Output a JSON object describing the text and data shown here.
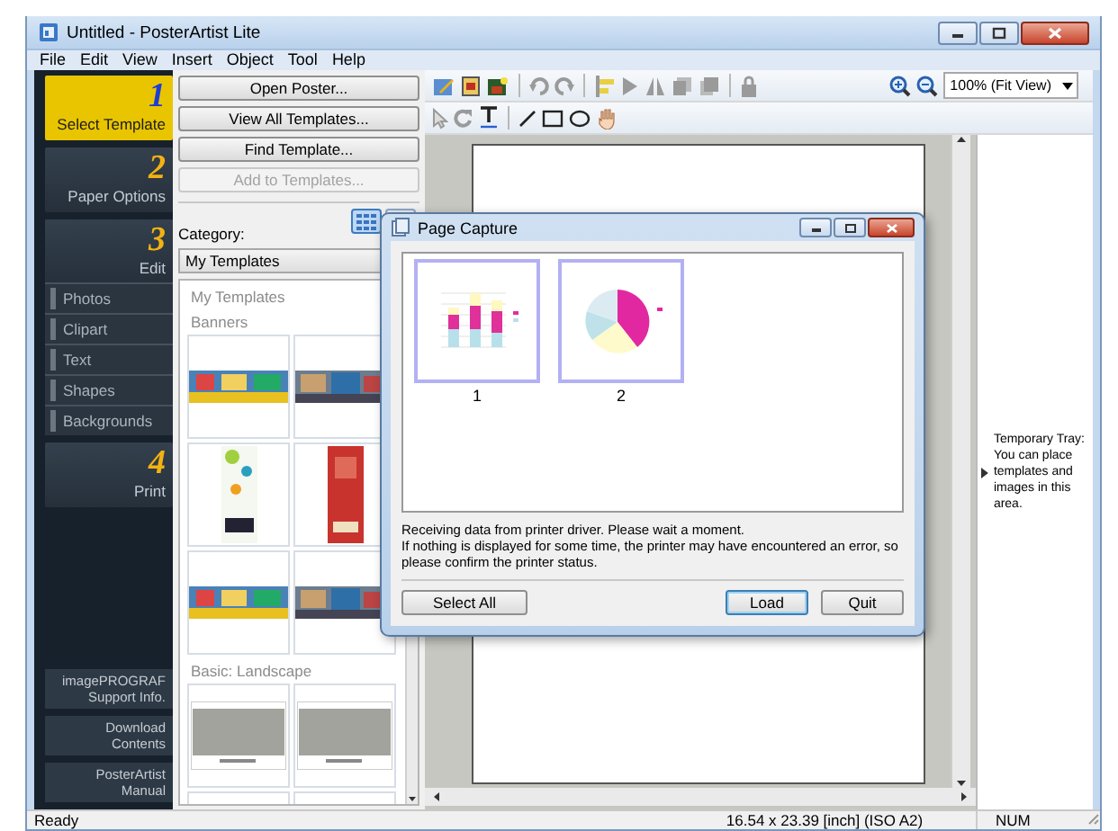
{
  "window": {
    "title": "Untitled - PosterArtist Lite"
  },
  "menu": [
    "File",
    "Edit",
    "View",
    "Insert",
    "Object",
    "Tool",
    "Help"
  ],
  "steps": [
    {
      "number": "1",
      "label": "Select Template",
      "selected": true
    },
    {
      "number": "2",
      "label": "Paper Options",
      "selected": false
    },
    {
      "number": "3",
      "label": "Edit",
      "selected": false,
      "tools": [
        "Photos",
        "Clipart",
        "Text",
        "Shapes",
        "Backgrounds"
      ]
    },
    {
      "number": "4",
      "label": "Print",
      "selected": false
    }
  ],
  "sidebar_links": [
    "imagePROGRAF Support Info.",
    "Download Contents",
    "PosterArtist Manual"
  ],
  "template_panel": {
    "buttons": [
      {
        "label": "Open Poster...",
        "disabled": false
      },
      {
        "label": "View All Templates...",
        "disabled": false
      },
      {
        "label": "Find Template...",
        "disabled": false
      },
      {
        "label": "Add to Templates...",
        "disabled": true
      }
    ],
    "view_modes": [
      {
        "kind": "grid",
        "selected": true
      },
      {
        "kind": "list",
        "selected": false
      }
    ],
    "category_label": "Category:",
    "category": "My Templates",
    "groups": [
      {
        "heading": "My Templates"
      },
      {
        "heading": "Banners",
        "templates": [
          {
            "kind": "wide"
          },
          {
            "kind": "wide"
          },
          {
            "kind": "tall"
          },
          {
            "kind": "tall"
          },
          {
            "kind": "wide"
          },
          {
            "kind": "wide"
          }
        ]
      },
      {
        "heading": "Basic: Landscape",
        "templates": [
          {
            "kind": "layout"
          },
          {
            "kind": "layout"
          },
          {
            "kind": "layout"
          },
          {
            "kind": "layout"
          }
        ]
      }
    ]
  },
  "toolbar": {
    "zoom": "100% (Fit View)"
  },
  "tray": {
    "text": "Temporary Tray: You can place templates and images in this area."
  },
  "dialog": {
    "title": "Page Capture",
    "pages": [
      {
        "label": "1",
        "kind": "bar"
      },
      {
        "label": "2",
        "kind": "pie"
      }
    ],
    "message": [
      "Receiving data from printer driver. Please wait a moment.",
      "If nothing is displayed for some time, the printer may have encountered an error, so please confirm the printer status."
    ],
    "buttons": [
      {
        "label": "Select All",
        "default": false
      },
      {
        "label": "Load",
        "default": true
      },
      {
        "label": "Quit",
        "default": false
      }
    ]
  },
  "status_bar": [
    "Ready",
    "16.54 x 23.39 [inch] (ISO A2)",
    "NUM"
  ]
}
